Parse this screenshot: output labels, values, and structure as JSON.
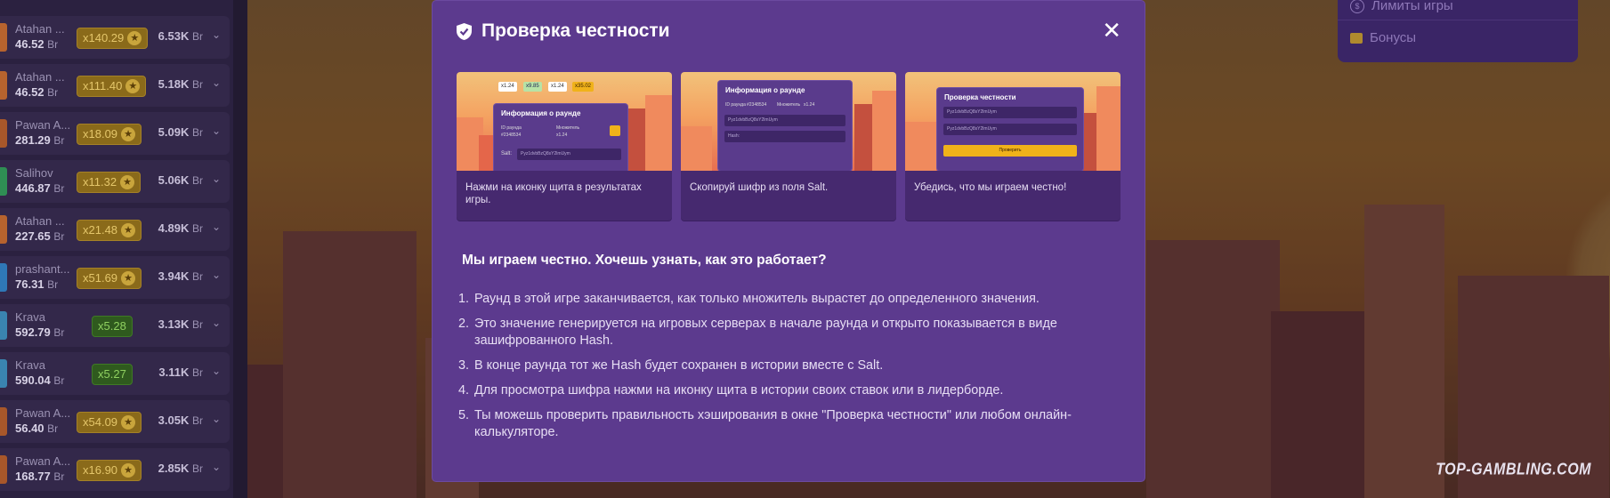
{
  "bets": [
    {
      "name": "Atahan ...",
      "amount": "46.52",
      "currency": "Br",
      "multiplier": "x140.29",
      "win": "6.53K",
      "win_currency": "Br",
      "style": "gold",
      "avatar": "#b7632e"
    },
    {
      "name": "Atahan ...",
      "amount": "46.52",
      "currency": "Br",
      "multiplier": "x111.40",
      "win": "5.18K",
      "win_currency": "Br",
      "style": "gold",
      "avatar": "#b7632e"
    },
    {
      "name": "Pawan A...",
      "amount": "281.29",
      "currency": "Br",
      "multiplier": "x18.09",
      "win": "5.09K",
      "win_currency": "Br",
      "style": "gold",
      "avatar": "#a8572a"
    },
    {
      "name": "Salihov",
      "amount": "446.87",
      "currency": "Br",
      "multiplier": "x11.32",
      "win": "5.06K",
      "win_currency": "Br",
      "style": "gold",
      "avatar": "#2f8e54"
    },
    {
      "name": "Atahan ...",
      "amount": "227.65",
      "currency": "Br",
      "multiplier": "x21.48",
      "win": "4.89K",
      "win_currency": "Br",
      "style": "gold",
      "avatar": "#b7632e"
    },
    {
      "name": "prashant...",
      "amount": "76.31",
      "currency": "Br",
      "multiplier": "x51.69",
      "win": "3.94K",
      "win_currency": "Br",
      "style": "gold",
      "avatar": "#2f78b7"
    },
    {
      "name": "Krava",
      "amount": "592.79",
      "currency": "Br",
      "multiplier": "x5.28",
      "win": "3.13K",
      "win_currency": "Br",
      "style": "green",
      "avatar": "#3a84b0"
    },
    {
      "name": "Krava",
      "amount": "590.04",
      "currency": "Br",
      "multiplier": "x5.27",
      "win": "3.11K",
      "win_currency": "Br",
      "style": "green",
      "avatar": "#3a84b0"
    },
    {
      "name": "Pawan A...",
      "amount": "56.40",
      "currency": "Br",
      "multiplier": "x54.09",
      "win": "3.05K",
      "win_currency": "Br",
      "style": "gold",
      "avatar": "#a8572a"
    },
    {
      "name": "Pawan A...",
      "amount": "168.77",
      "currency": "Br",
      "multiplier": "x16.90",
      "win": "2.85K",
      "win_currency": "Br",
      "style": "gold",
      "avatar": "#a8572a"
    }
  ],
  "menu": {
    "limits_label": "Лимиты игры",
    "bonuses_label": "Бонусы"
  },
  "watermark": "TOP-GAMBLING.COM",
  "modal": {
    "title": "Проверка честности",
    "close_symbol": "✕",
    "steps": [
      {
        "caption": "Нажми на иконку щита в результатах игры."
      },
      {
        "caption": "Скопируй шифр из поля Salt."
      },
      {
        "caption": "Убедись, что мы играем честно!"
      }
    ],
    "heading": "Мы играем честно. Хочешь узнать, как это работает?",
    "list": [
      "Раунд в этой игре заканчивается, как только множитель вырастет до определенного значения.",
      "Это значение генерируется на игровых серверах в начале раунда и открыто показывается в виде зашифрованного Hash.",
      "В конце раунда тот же Hash будет сохранен в истории вместе с Salt.",
      "Для просмотра шифра нажми на иконку щита в истории своих ставок или в лидерборде.",
      "Ты можешь проверить правильность хэширования в окне \"Проверка честности\" или любом онлайн-калькуляторе."
    ],
    "illustration": {
      "round_info_title": "Информация о раунде",
      "round_id_label": "ID раунда",
      "round_id": "#2348534",
      "multiplier_label": "Множитель",
      "multiplier": "x1.24",
      "salt_label": "Salt:",
      "salt_value": "Pyz1dvbBzQ8sY2lmUym",
      "hash_label": "Hash:",
      "fairness_title": "Проверка честности",
      "check_button": "Проверить",
      "history": [
        "x1.24",
        "x9.85",
        "x1.24",
        "x35.02"
      ]
    }
  },
  "colors": {
    "modal_bg": "#5c3a8e",
    "card_bg": "#46296f",
    "accent_gold": "#f0b21a"
  }
}
